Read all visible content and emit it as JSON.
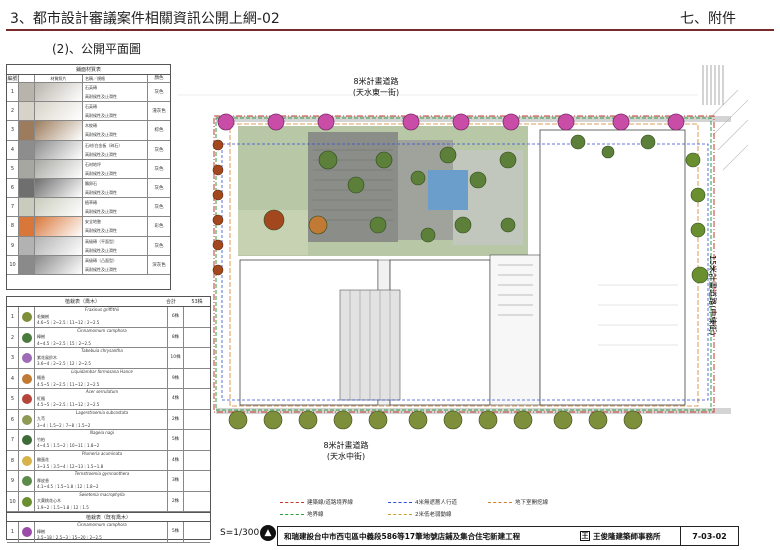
{
  "header": {
    "title": "3、都市設計審議案件相關資訊公開上網-02",
    "section": "七、附件",
    "subtitle": "(2)、公開平面圖"
  },
  "materials_table": {
    "heading": "鋪面材質表",
    "columns": [
      "編號",
      "材質照片",
      "名稱／規格",
      "顏色"
    ],
    "rows": [
      {
        "no": "1",
        "name": "石英磚",
        "spec": "高耐候性及止滑性",
        "color": "灰色",
        "swatch": "#b9b4ab"
      },
      {
        "no": "2",
        "name": "石英磚",
        "spec": "高耐候性及止滑性",
        "color": "淺灰色",
        "swatch": "#d8d3c8"
      },
      {
        "no": "3",
        "name": "木紋磚",
        "spec": "高耐候性及止滑性",
        "color": "棕色",
        "swatch": "#9c7c5c"
      },
      {
        "no": "4",
        "name": "石材/白金板（碎石）",
        "spec": "高耐候性及止滑性",
        "color": "灰色",
        "swatch": "#8d8d8d"
      },
      {
        "no": "5",
        "name": "石材地坪",
        "spec": "高耐候性及止滑性",
        "color": "灰色",
        "swatch": "#a7a7a2"
      },
      {
        "no": "6",
        "name": "鵝卵石",
        "spec": "高耐候性及止滑性",
        "color": "灰色",
        "swatch": "#6f6f6f"
      },
      {
        "no": "7",
        "name": "植草磚",
        "spec": "高耐候性及止滑性",
        "color": "灰色",
        "swatch": "#c9cbbc"
      },
      {
        "no": "8",
        "name": "安全地墊",
        "spec": "高耐候性及止滑性",
        "color": "彩色",
        "swatch": "#d9773a"
      },
      {
        "no": "9",
        "name": "高級磚（平面型）",
        "spec": "高耐候性及止滑性",
        "color": "灰色",
        "swatch": "#b2b2b2"
      },
      {
        "no": "10",
        "name": "高級磚（凸面型）",
        "spec": "高耐候性及止滑性",
        "color": "深灰色",
        "swatch": "#8a8a8a"
      }
    ]
  },
  "tree_table": {
    "heading": "植栽表（喬木）",
    "total_label": "合計",
    "total_value": "53株",
    "rows": [
      {
        "no": "1",
        "name": "毛欒樹",
        "sci": "Fraxinus griffithii",
        "size": "4.6~5｜2~2.5｜11~12｜2~2.5",
        "qty": "6株",
        "color": "#7d8f3a"
      },
      {
        "no": "2",
        "name": "樟樹",
        "sci": "Cinnamomum camphora",
        "size": "4~4.5｜2~2.5｜15｜2~2.5",
        "qty": "8株",
        "color": "#4b7a3d"
      },
      {
        "no": "3",
        "name": "紫花風鈴木",
        "sci": "Tabebuia chrysantha",
        "size": "3.6~4｜2~2.5｜12｜2~2.5",
        "qty": "10株",
        "color": "#9e6bb5"
      },
      {
        "no": "4",
        "name": "楓香",
        "sci": "Liquidambar formosana Hance",
        "size": "4.5~5｜2~2.5｜11~12｜2~2.5",
        "qty": "9株",
        "color": "#c07a34"
      },
      {
        "no": "5",
        "name": "紅楓",
        "sci": "Acer serrulatum",
        "size": "4.5~5｜2~2.5｜11~12｜2~2.5",
        "qty": "4株",
        "color": "#b5453a"
      },
      {
        "no": "6",
        "name": "九芎",
        "sci": "Lagerstroemia subcostata",
        "size": "3~4｜1.5~2｜7~8｜1.5~2",
        "qty": "2株",
        "color": "#8f9a55"
      },
      {
        "no": "7",
        "name": "竹柏",
        "sci": "Nageia nagi",
        "size": "4~4.5｜1.5~2｜10~11｜1.8~2",
        "qty": "5株",
        "color": "#3f6b3a"
      },
      {
        "no": "8",
        "name": "雞蛋花",
        "sci": "Plumeria acuminata",
        "size": "3~3.5｜3.5~4｜12~13｜1.5~1.8",
        "qty": "4株",
        "color": "#d6b34a"
      },
      {
        "no": "9",
        "name": "厚皮香",
        "sci": "Ternstroemia gymnanthera",
        "size": "4.1~4.5｜1.5~1.8｜12｜1.8~2",
        "qty": "3株",
        "color": "#5b8a4b"
      },
      {
        "no": "10",
        "name": "大葉桃花心木",
        "sci": "Swietenia macrophylla",
        "size": "1.9~2｜1.5~1.8｜12｜1.5",
        "qty": "2株",
        "color": "#6a8f2e"
      }
    ],
    "extra_heading": "植栽表（既有喬木）",
    "extra_row": {
      "no": "1",
      "name": "樟樹",
      "sci": "Cinnamomum camphora",
      "size": "3.5~18｜2.5~3｜15~20｜2~2.5",
      "qty": "5株",
      "color": "#9a4ba8"
    }
  },
  "plan": {
    "north_road": "8米計畫道路\n(天水東一街)",
    "south_road": "8米計畫道路\n(天水中街)",
    "east_road": "15米計畫道路(中棟街)",
    "legend": [
      {
        "label": "建築線/道路境界線",
        "color": "#c0392b"
      },
      {
        "label": "4米無遮簷人行道",
        "color": "#2c4fd6"
      },
      {
        "label": "地下室開挖線",
        "color": "#d4812b"
      },
      {
        "label": "地界線",
        "color": "#2e9e3f"
      },
      {
        "label": "2米低老弱動線",
        "color": "#c9a02b"
      }
    ],
    "scale": "S=1/300"
  },
  "footer": {
    "project": "和瑞建設台中市西屯區中義段586等17筆地號店鋪及集合住宅新建工程",
    "firm": "王俊隆建築師事務所",
    "code": "7-03-02"
  },
  "colors": {
    "header_rule": "#7a2a2a",
    "tree_green": "#5c7f3a",
    "pink_tree": "#c94da6",
    "plaza_gray": "#8b8d88"
  }
}
